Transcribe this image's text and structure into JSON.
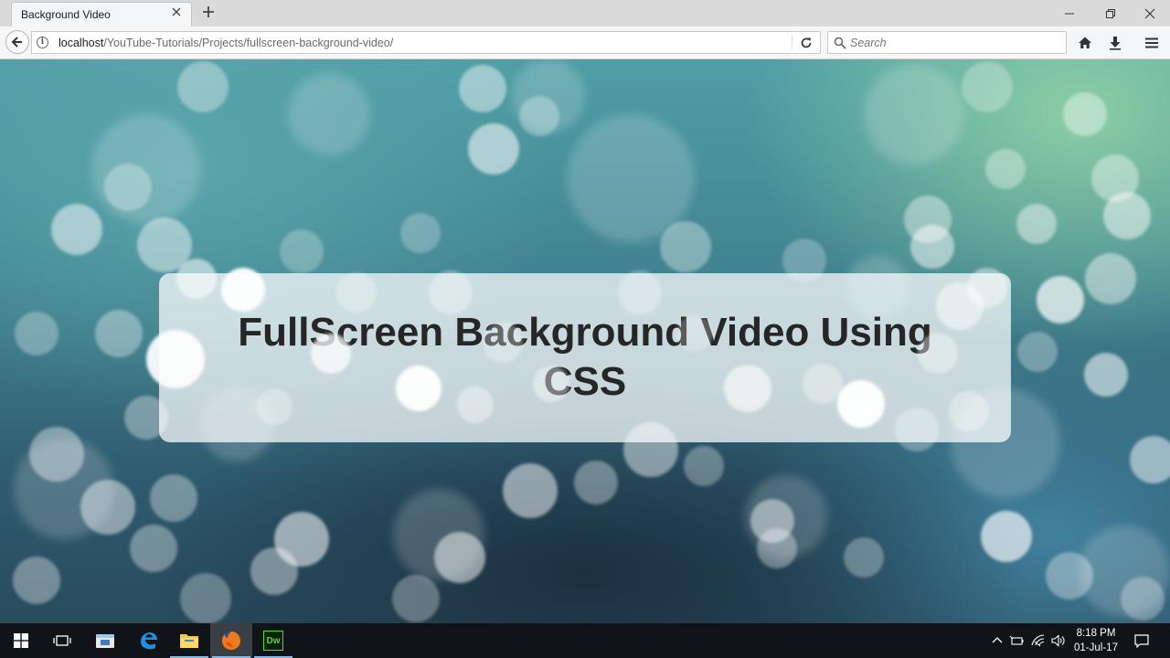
{
  "browser": {
    "tab": {
      "title": "Background Video",
      "close_icon": "close-icon"
    },
    "new_tab_icon": "plus-icon",
    "window_controls": [
      "minimize-icon",
      "restore-icon",
      "close-icon"
    ],
    "url": {
      "host": "localhost",
      "path": "/YouTube-Tutorials/Projects/fullscreen-background-video/"
    },
    "search": {
      "placeholder": "Search",
      "value": ""
    },
    "toolbar_icons": [
      "home-icon",
      "download-icon",
      "menu-icon"
    ]
  },
  "page": {
    "title": "FullScreen Background Video Using CSS"
  },
  "taskbar": {
    "apps": [
      "windows-start-icon",
      "task-view-icon",
      "store-icon",
      "edge-icon",
      "file-explorer-icon",
      "firefox-icon",
      "dreamweaver-icon"
    ],
    "dreamweaver_label": "Dw",
    "tray_icons": [
      "chevron-up-icon",
      "battery-icon",
      "wifi-icon",
      "volume-icon",
      "notification-icon"
    ],
    "clock": {
      "time": "8:18 PM",
      "date": "01-Jul-17"
    }
  }
}
